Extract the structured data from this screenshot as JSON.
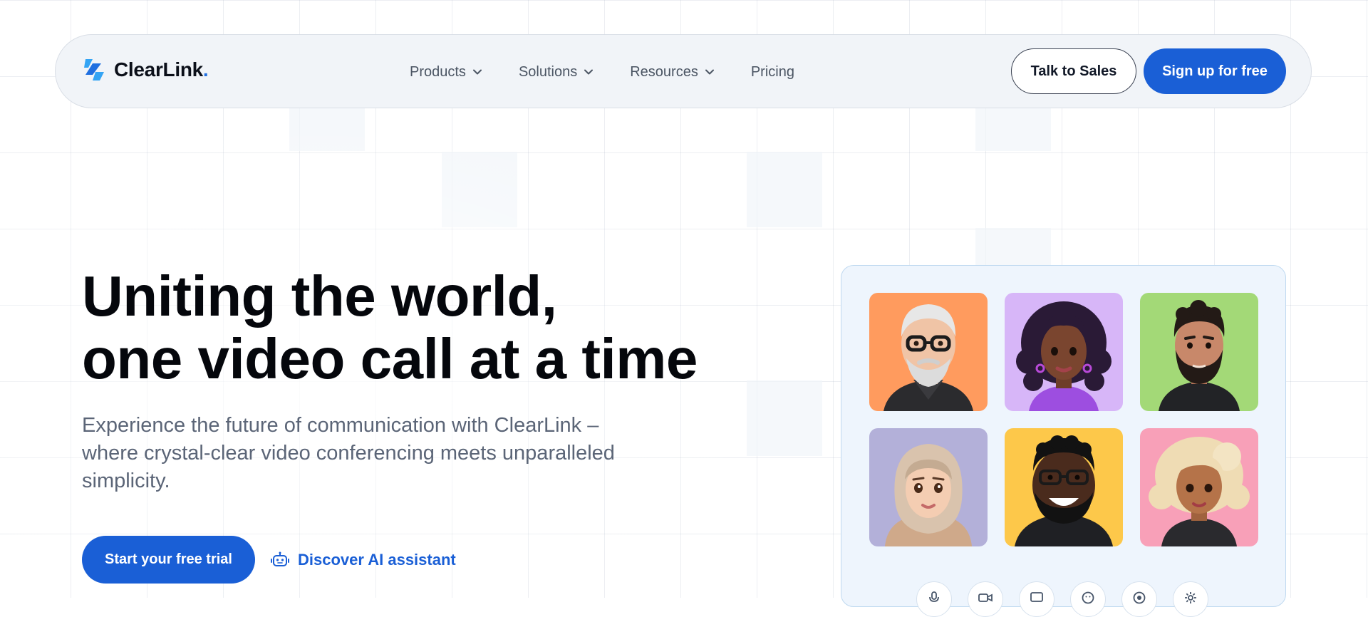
{
  "brand": {
    "name": "ClearLink",
    "dot": ".",
    "accent": "#1a5fd6"
  },
  "nav": {
    "items": [
      {
        "label": "Products",
        "has_dropdown": true,
        "icon": "chevron-down-icon"
      },
      {
        "label": "Solutions",
        "has_dropdown": true,
        "icon": "chevron-down-icon"
      },
      {
        "label": "Resources",
        "has_dropdown": true,
        "icon": "chevron-down-icon"
      },
      {
        "label": "Pricing",
        "has_dropdown": false
      }
    ],
    "talk_to_sales": "Talk to Sales",
    "sign_up": "Sign up for free"
  },
  "hero": {
    "title_line1": "Uniting the world,",
    "title_line2": "one video call at a time",
    "subtitle": "Experience the future of communication with ClearLink – where crystal-clear video conferencing meets unparalleled simplicity.",
    "cta_primary": "Start your free trial",
    "cta_secondary": "Discover AI assistant",
    "cta_secondary_icon": "robot-icon"
  },
  "video_panel": {
    "participants": [
      {
        "name": "participant-older-man-glasses",
        "bg": "#ff9b5e"
      },
      {
        "name": "participant-curly-hair-woman",
        "bg": "#d7b6f8"
      },
      {
        "name": "participant-bearded-man",
        "bg": "#a3d977"
      },
      {
        "name": "participant-woman-hijab",
        "bg": "#b3b0d9"
      },
      {
        "name": "participant-man-glasses-smiling",
        "bg": "#fdc84a"
      },
      {
        "name": "participant-blonde-woman",
        "bg": "#f8a0b8"
      }
    ],
    "controls": [
      "microphone-icon",
      "camera-icon",
      "chat-icon",
      "emoji-icon",
      "record-icon",
      "settings-icon"
    ]
  }
}
